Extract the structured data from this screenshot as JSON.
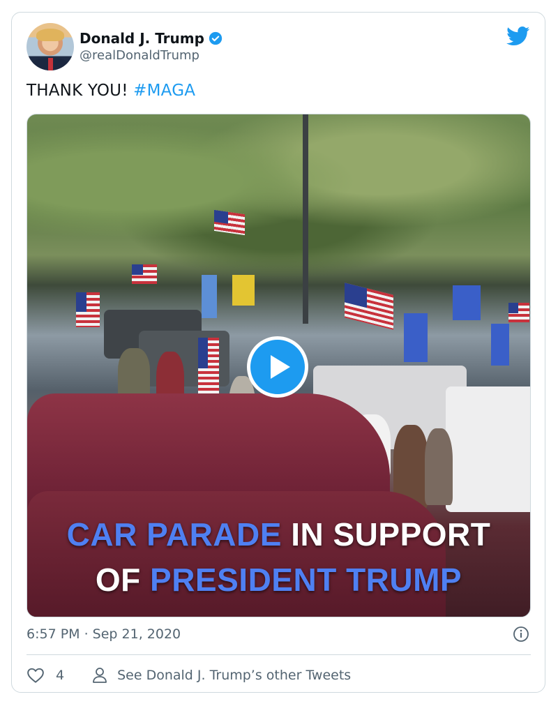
{
  "tweet": {
    "author": {
      "name": "Donald J. Trump",
      "handle": "@realDonaldTrump",
      "verified": true,
      "avatar_icon": "avatar-photo"
    },
    "text": {
      "plain": "THANK YOU!",
      "hashtag": "#MAGA"
    },
    "media": {
      "type": "video",
      "caption_line1_highlight": "CAR PARADE",
      "caption_line1_rest": " IN SUPPORT",
      "caption_line2_rest": "OF ",
      "caption_line2_highlight": "PRESIDENT TRUMP",
      "play_icon": "play-icon"
    },
    "timestamp": "6:57 PM · Sep 21, 2020",
    "likes": "4",
    "see_other": "See Donald J. Trump’s other Tweets"
  },
  "colors": {
    "accent": "#1d9bf0",
    "caption_highlight": "#4f80f2",
    "muted_text": "#536471",
    "border": "#cfd9de"
  }
}
